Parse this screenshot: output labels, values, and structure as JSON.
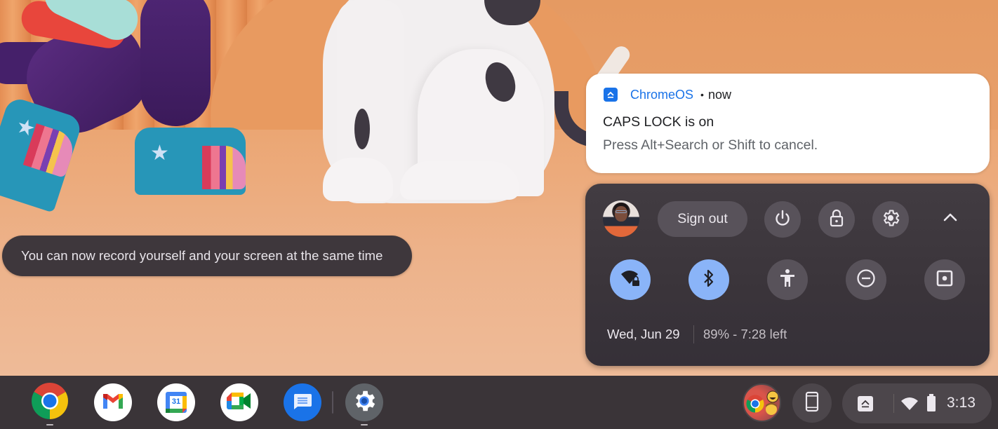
{
  "toast": {
    "text": "You can now record yourself and your screen at the same time"
  },
  "notification": {
    "app_icon": "chromeos-eject-icon",
    "app_name": "ChromeOS",
    "separator": "•",
    "time": "now",
    "title": "CAPS LOCK is on",
    "body": "Press Alt+Search or Shift to cancel.",
    "accent_color": "#1a73e8"
  },
  "quick_settings": {
    "avatar": "user-avatar",
    "sign_out_label": "Sign out",
    "top_buttons": [
      {
        "name": "power",
        "icon": "power-icon"
      },
      {
        "name": "lock",
        "icon": "lock-icon"
      },
      {
        "name": "settings",
        "icon": "gear-icon"
      },
      {
        "name": "collapse",
        "icon": "chevron-up-icon"
      }
    ],
    "feature_toggles": [
      {
        "name": "wifi",
        "icon": "wifi-lock-icon",
        "on": true
      },
      {
        "name": "bluetooth",
        "icon": "bluetooth-icon",
        "on": true
      },
      {
        "name": "accessibility",
        "icon": "accessibility-icon",
        "on": false
      },
      {
        "name": "do-not-disturb",
        "icon": "do-not-disturb-icon",
        "on": false
      },
      {
        "name": "screen-capture",
        "icon": "screen-capture-icon",
        "on": false
      }
    ],
    "date": "Wed, Jun 29",
    "battery_status": "89% - 7:28 left",
    "toggle_on_color": "#8ab4f8"
  },
  "shelf": {
    "apps": [
      {
        "name": "Chrome",
        "icon": "chrome-icon",
        "running": true
      },
      {
        "name": "Gmail",
        "icon": "gmail-icon",
        "running": false
      },
      {
        "name": "Google Calendar",
        "icon": "calendar-icon",
        "label": "31",
        "running": false
      },
      {
        "name": "Google Meet",
        "icon": "meet-icon",
        "running": false
      },
      {
        "name": "Messages",
        "icon": "messages-icon",
        "running": false
      },
      {
        "name": "Settings",
        "icon": "settings-app-icon",
        "running": true
      }
    ],
    "tray": {
      "holding_space": "holding-space-icon",
      "phone_hub": "phone-icon",
      "notification_icon": "chromeos-eject-icon",
      "wifi": "wifi-icon",
      "battery": "battery-icon",
      "time": "3:13"
    }
  }
}
